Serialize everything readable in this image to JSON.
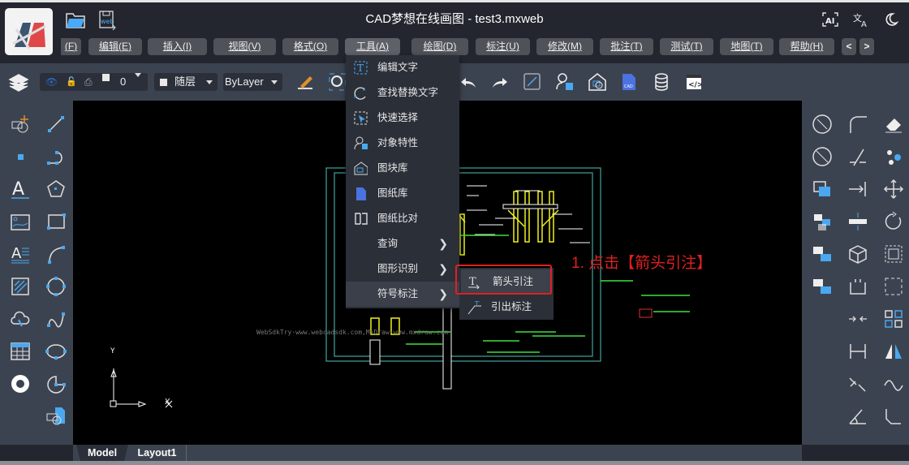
{
  "app": {
    "title": "CAD梦想在线画图 - test3.mxweb"
  },
  "header_icons": [
    "ai-icon",
    "translate-icon",
    "moon-icon"
  ],
  "menubar": {
    "items": [
      "(F)",
      "编辑(E)",
      "插入(I)",
      "视图(V)",
      "格式(O)",
      "工具(A)",
      "绘图(D)",
      "标注(U)",
      "修改(M)",
      "批注(T)",
      "测试(T)",
      "地图(T)",
      "帮助(H)"
    ],
    "prev": "<",
    "next": ">"
  },
  "toolbar": {
    "layer_value": "0",
    "color_value": "随层",
    "linetype_value": "ByLayer"
  },
  "tools_menu": {
    "items": [
      {
        "label": "编辑文字",
        "icon": "edit-text-icon"
      },
      {
        "label": "查找替换文字",
        "icon": "find-replace-icon"
      },
      {
        "label": "快速选择",
        "icon": "quick-select-icon"
      },
      {
        "label": "对象特性",
        "icon": "properties-icon"
      },
      {
        "label": "图块库",
        "icon": "block-library-icon"
      },
      {
        "label": "图纸库",
        "icon": "drawing-library-icon"
      },
      {
        "label": "图纸比对",
        "icon": "compare-icon"
      },
      {
        "label": "查询",
        "submenu": true
      },
      {
        "label": "图形识别",
        "submenu": true
      },
      {
        "label": "符号标注",
        "submenu": true
      }
    ]
  },
  "submenu": {
    "items": [
      "箭头引注",
      "引出标注"
    ]
  },
  "annotation": "1. 点击【箭头引注】",
  "canvas": {
    "watermark": "WebSdkTry·www.webcadsdk.com,MxDraw·www.mxdraw.com",
    "axis_x": "X",
    "axis_y": "Y"
  },
  "tabs": [
    "Model",
    "Layout1"
  ],
  "colors": {
    "accent": "#4aa8f0",
    "highlight": "#e02020",
    "menu_bg": "#2b2f38"
  }
}
